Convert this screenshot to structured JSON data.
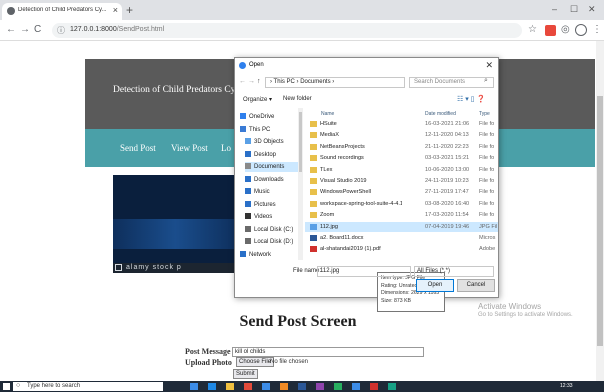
{
  "browser": {
    "tab_title": "Detection of Child Predators Cy...",
    "new_tab": "+",
    "url_host": "127.0.0.1:8000",
    "url_path": "/SendPost.html",
    "win_min": "–",
    "win_max": "☐",
    "win_close": "✕"
  },
  "site": {
    "title": "Detection of Child Predators Cyber Ha",
    "nav": [
      "Send Post",
      "View Post",
      "Lo"
    ],
    "hero_caption": "alamy stock p"
  },
  "form": {
    "heading": "Send Post Screen",
    "message_label": "Post Message",
    "message_value": "kill ol childs",
    "photo_label": "Upload Photo",
    "choose_file": "Choose File",
    "no_file": "No file chosen",
    "submit": "Submit"
  },
  "windows_watermark": {
    "line1": "Activate Windows",
    "line2": "Go to Settings to activate Windows."
  },
  "dialog": {
    "title": "Open",
    "breadcrumb": "› This PC › Documents ›",
    "search_placeholder": "Search Documents",
    "organize": "Organize ▾",
    "new_folder": "New folder",
    "columns": {
      "name": "Name",
      "date": "Date modified",
      "type": "Type"
    },
    "tree": [
      {
        "label": "OneDrive",
        "color": "#2f80ed"
      },
      {
        "label": "This PC",
        "color": "#3a7bd5"
      },
      {
        "label": "3D Objects",
        "color": "#5aa0e6"
      },
      {
        "label": "Desktop",
        "color": "#2a70c8"
      },
      {
        "label": "Documents",
        "color": "#8a8a8a"
      },
      {
        "label": "Downloads",
        "color": "#2a70c8"
      },
      {
        "label": "Music",
        "color": "#2a70c8"
      },
      {
        "label": "Pictures",
        "color": "#2a70c8"
      },
      {
        "label": "Videos",
        "color": "#333333"
      },
      {
        "label": "Local Disk (C:)",
        "color": "#6a6a6a"
      },
      {
        "label": "Local Disk (D:)",
        "color": "#6a6a6a"
      },
      {
        "label": "Network",
        "color": "#2a70c8"
      }
    ],
    "files": [
      {
        "name": "HSuite",
        "date": "16-03-2021 21:06",
        "type": "File fo",
        "color": "#e8c04a"
      },
      {
        "name": "MediaX",
        "date": "12-11-2020 04:13",
        "type": "File fo",
        "color": "#e8c04a"
      },
      {
        "name": "NetBeansProjects",
        "date": "21-11-2020 22:23",
        "type": "File fo",
        "color": "#e8c04a"
      },
      {
        "name": "Sound recordings",
        "date": "03-03-2021 15:21",
        "type": "File fo",
        "color": "#e8c04a"
      },
      {
        "name": "TLex",
        "date": "10-06-2020 13:00",
        "type": "File fo",
        "color": "#e8c04a"
      },
      {
        "name": "Visual Studio 2019",
        "date": "24-11-2019 10:23",
        "type": "File fo",
        "color": "#e8c04a"
      },
      {
        "name": "WindowsPowerShell",
        "date": "27-11-2019 17:47",
        "type": "File fo",
        "color": "#e8c04a"
      },
      {
        "name": "workspace-spring-tool-suite-4-4.1.1.RE...",
        "date": "03-08-2020 16:40",
        "type": "File fo",
        "color": "#e8c04a"
      },
      {
        "name": "Zoom",
        "date": "17-03-2020 11:54",
        "type": "File fo",
        "color": "#e8c04a"
      },
      {
        "name": "112.jpg",
        "date": "07-04-2019 19:46",
        "type": "JPG Fil",
        "color": "#5aa0e6",
        "selected": true
      },
      {
        "name": "a2. Board11.docx",
        "date": "",
        "type": "Micros",
        "color": "#2b5797"
      },
      {
        "name": "al-shatandai2019 (1).pdf",
        "date": "",
        "type": "Adobe",
        "color": "#d0312d"
      }
    ],
    "tooltip": [
      "Item type: JPG File",
      "Rating: Unrated",
      "Dimensions: 2629 x 1165",
      "Size: 873 KB"
    ],
    "file_name_label": "File name:",
    "file_name_value": "112.jpg",
    "filter": "All Files (*.*)",
    "open": "Open",
    "cancel": "Cancel"
  },
  "taskbar": {
    "search": "Type here to search",
    "clock": "12:33"
  }
}
